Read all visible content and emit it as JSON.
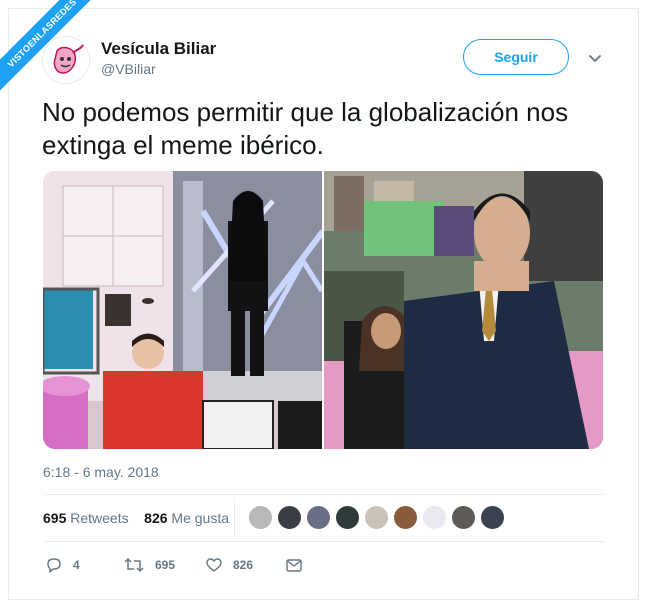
{
  "watermark": "VISTOENLASREDES",
  "user": {
    "display_name": "Vesícula Biliar",
    "handle": "@VBiliar",
    "avatar_icon": "gallbladder-logo-icon"
  },
  "follow_button": "Seguir",
  "menu_icon": "chevron-down-icon",
  "tweet": {
    "text": "No podemos permitir que la globalización nos extinga el meme ibérico.",
    "timestamp": "6:18 - 6 may. 2018"
  },
  "media": {
    "left_photo_icon": "tv-studio-photo",
    "right_photo_icon": "premiere-photo"
  },
  "stats": {
    "retweets_count": "695",
    "retweets_label": "Retweets",
    "likes_count": "826",
    "likes_label": "Me gusta"
  },
  "likers_count": 9,
  "actions": {
    "reply_count": "4",
    "retweet_count": "695",
    "like_count": "826"
  },
  "colors": {
    "brand": "#1da1f2",
    "muted": "#657786",
    "text": "#14171a",
    "border": "#e6ecf0"
  }
}
